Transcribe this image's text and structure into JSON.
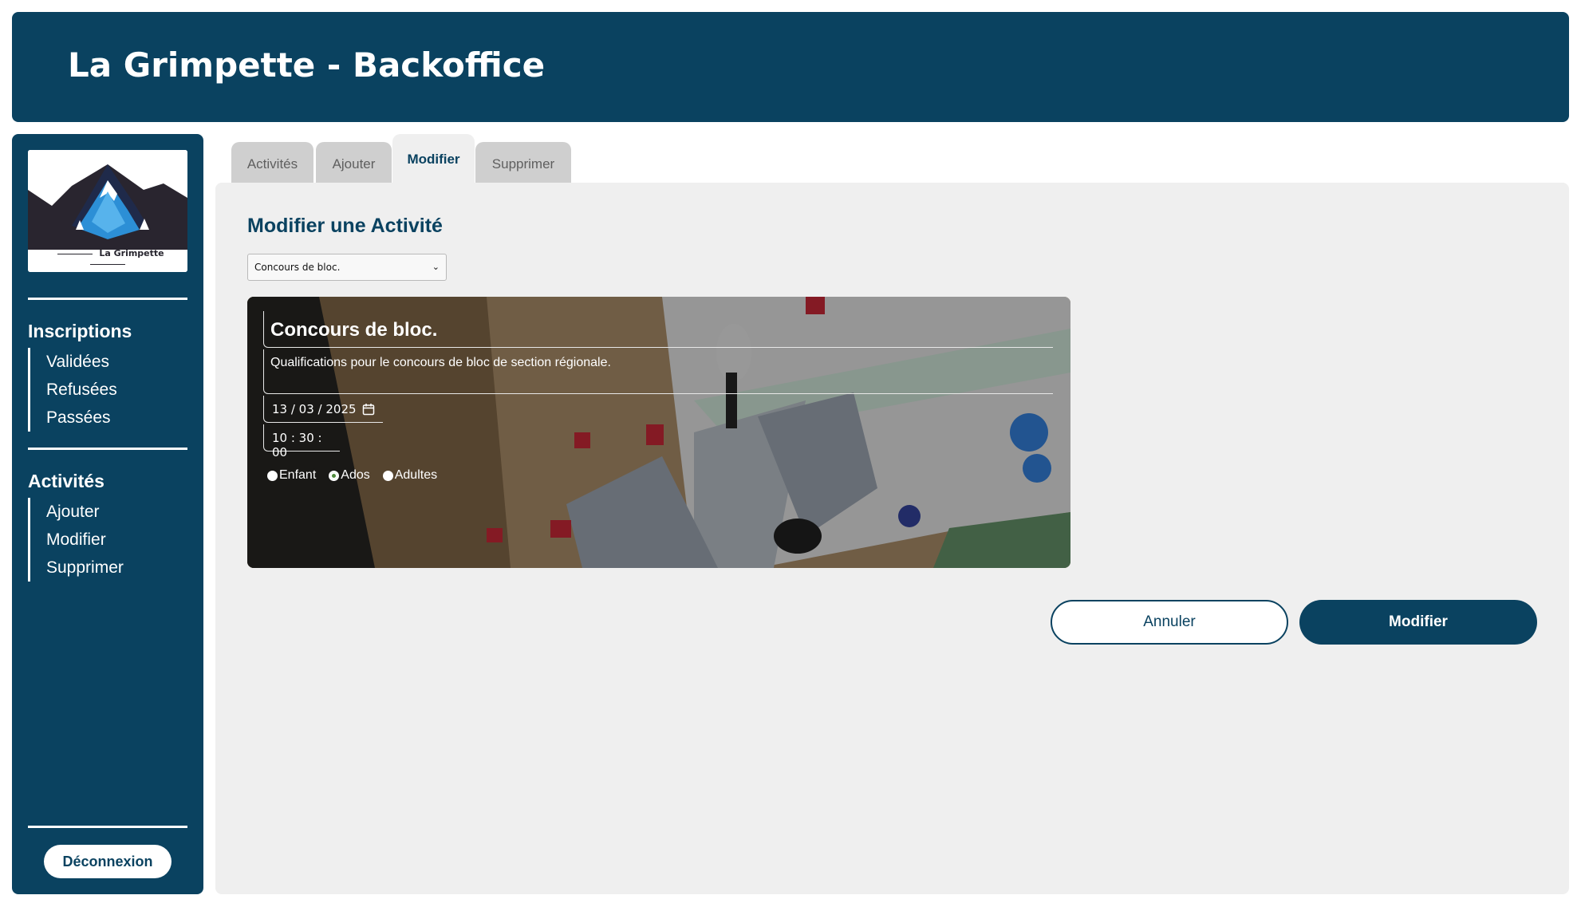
{
  "header": {
    "title": "La Grimpette - Backoffice"
  },
  "sidebar": {
    "logo_caption": "La Grimpette",
    "sections": [
      {
        "heading": "Inscriptions",
        "items": [
          "Validées",
          "Refusées",
          "Passées"
        ]
      },
      {
        "heading": "Activités",
        "items": [
          "Ajouter",
          "Modifier",
          "Supprimer"
        ]
      }
    ],
    "logout_label": "Déconnexion"
  },
  "tabs": [
    {
      "label": "Activités",
      "active": false
    },
    {
      "label": "Ajouter",
      "active": false
    },
    {
      "label": "Modifier",
      "active": true
    },
    {
      "label": "Supprimer",
      "active": false
    }
  ],
  "main": {
    "title": "Modifier une Activité",
    "select": {
      "selected": "Concours de bloc."
    },
    "activity": {
      "title": "Concours de bloc.",
      "description": "Qualifications pour le concours de bloc de section régionale.",
      "date": "13 / 03 / 2025",
      "time": "10 : 30 : 00",
      "audience_options": [
        "Enfant",
        "Ados",
        "Adultes"
      ],
      "audience_selected": "Ados"
    },
    "cancel_label": "Annuler",
    "submit_label": "Modifier"
  },
  "colors": {
    "primary": "#0a4260",
    "panel": "#efefef",
    "tab_inactive": "#cfcfcf"
  },
  "icons": [
    "chevron-down-icon",
    "calendar-icon",
    "mountain-logo"
  ]
}
